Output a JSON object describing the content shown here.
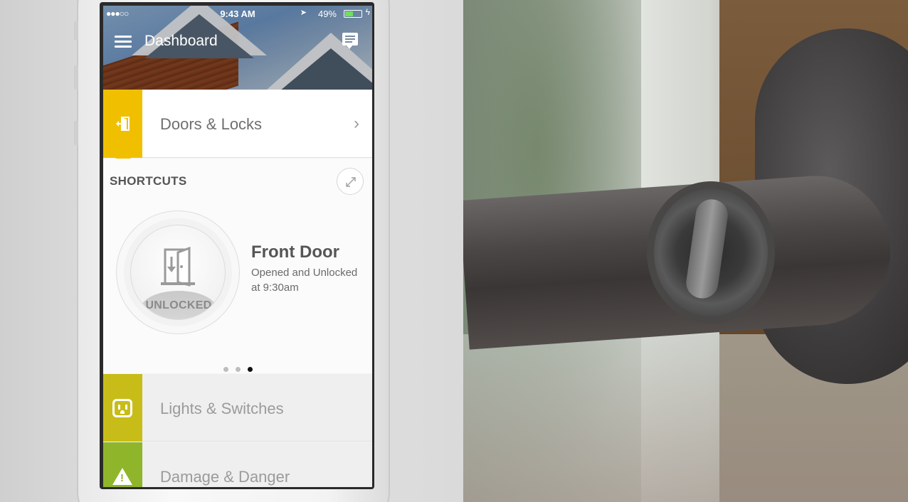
{
  "status_bar": {
    "signal": "●●●○○",
    "time": "9:43 AM",
    "battery_percent": "49%",
    "battery_level": 0.49,
    "icons": [
      "location-arrow-icon",
      "battery-icon",
      "charging-bolt-icon"
    ]
  },
  "nav": {
    "title": "Dashboard",
    "icons": [
      "hamburger-menu-icon",
      "message-icon"
    ]
  },
  "doors": {
    "label": "Doors & Locks",
    "chevron": "›",
    "accent": "#f0c000",
    "icon": "door-exit-icon"
  },
  "shortcuts": {
    "title": "SHORTCUTS",
    "expand_icon": "expand-arrows-icon",
    "card": {
      "status_badge": "UNLOCKED",
      "name": "Front Door",
      "status_text": "Opened and Unlocked at 9:30am",
      "icon": "open-door-icon"
    },
    "pager": {
      "pages": 3,
      "active": 3
    }
  },
  "categories": [
    {
      "label": "Lights & Switches",
      "accent": "#c8bd18",
      "icon": "power-outlet-icon"
    },
    {
      "label": "Damage & Danger",
      "accent": "#8fb52a",
      "icon": "warning-triangle-icon"
    }
  ]
}
